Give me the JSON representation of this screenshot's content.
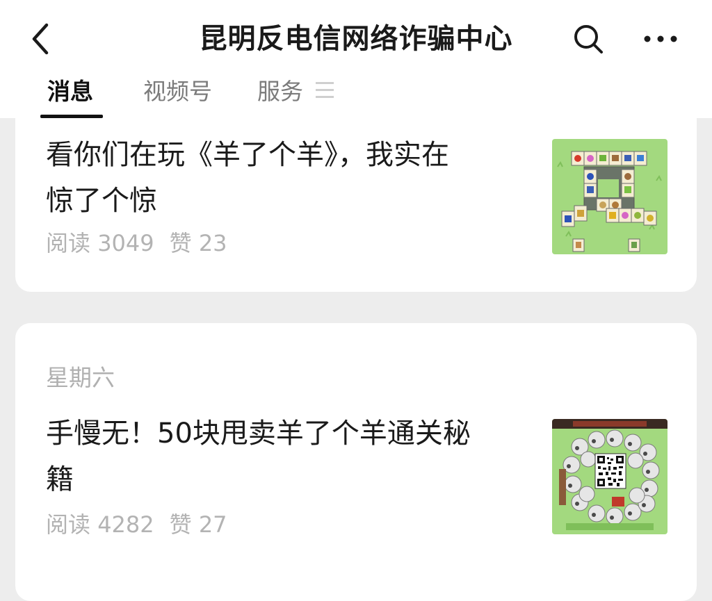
{
  "header": {
    "title": "昆明反电信网络诈骗中心",
    "back_icon": "chevron-left-icon",
    "search_icon": "search-icon",
    "more_icon": "more-dots-icon"
  },
  "tabs": [
    {
      "label": "消息",
      "active": true
    },
    {
      "label": "视频号",
      "active": false
    },
    {
      "label": "服务",
      "active": false
    }
  ],
  "articles": [
    {
      "title_line1": "看你们在玩《羊了个羊》，我实在",
      "title_line2": "惊了个惊",
      "read_label": "阅读",
      "read_count": "3049",
      "like_label": "赞",
      "like_count": "23"
    },
    {
      "date": "星期六",
      "title_line1": "手慢无！50块甩卖羊了个羊通关秘",
      "title_line2": "籍",
      "read_label": "阅读",
      "read_count": "4282",
      "like_label": "赞",
      "like_count": "27"
    }
  ],
  "colors": {
    "background": "#ededed",
    "card": "#ffffff",
    "muted_text": "#b3b3b3",
    "thumb_green": "#9bd37a"
  }
}
